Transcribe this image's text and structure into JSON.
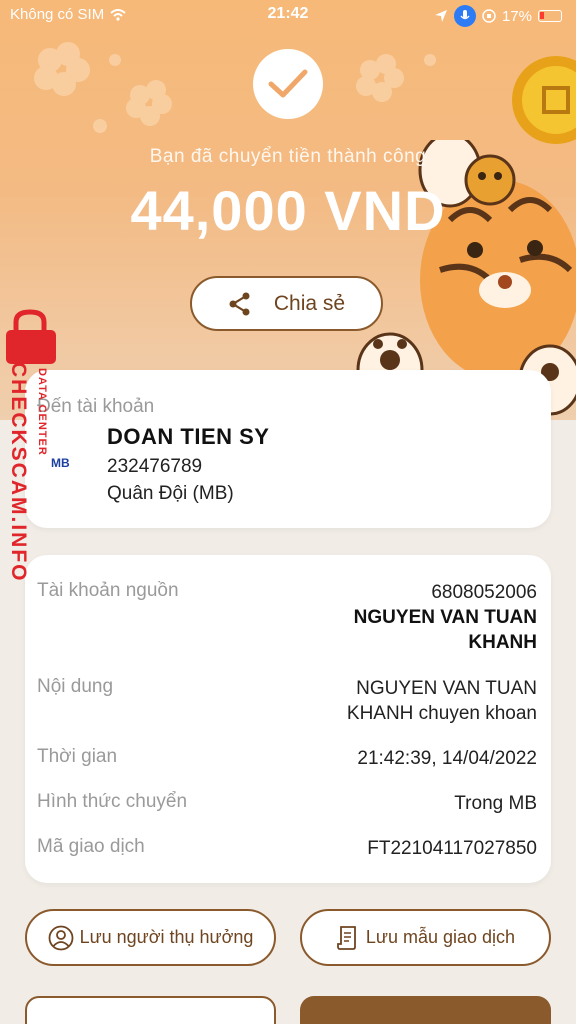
{
  "status_bar": {
    "carrier": "Không có SIM",
    "time": "21:42",
    "battery": "17%"
  },
  "hero": {
    "success_message": "Bạn đã chuyển tiền thành công",
    "amount": "44,000 VND",
    "share_label": "Chia sẻ"
  },
  "recipient": {
    "label": "Đến tài khoản",
    "name": "DOAN TIEN SY",
    "account": "232476789",
    "bank": "Quân Đội (MB)",
    "bank_logo": "MB"
  },
  "details": {
    "source_label": "Tài khoản nguồn",
    "source_account": "6808052006",
    "source_name_line1": "NGUYEN VAN TUAN",
    "source_name_line2": "KHANH",
    "content_label": "Nội dung",
    "content_line1": "NGUYEN VAN TUAN",
    "content_line2": "KHANH chuyen khoan",
    "time_label": "Thời gian",
    "time_value": "21:42:39, 14/04/2022",
    "method_label": "Hình thức chuyển",
    "method_value": "Trong MB",
    "txn_label": "Mã giao dịch",
    "txn_value": "FT22104117027850"
  },
  "actions": {
    "save_beneficiary": "Lưu người thụ hưởng",
    "save_template": "Lưu mẫu giao dịch"
  },
  "watermark": {
    "main": "CHECKSCAM.INFO",
    "sub": "DATA CENTER"
  },
  "icons": {
    "check": "check-icon",
    "share": "share-icon",
    "person": "person-icon",
    "document": "document-icon"
  },
  "colors": {
    "accent_brown": "#8a5a2c",
    "hero_orange": "#f6b978",
    "watermark_red": "#e0262b"
  }
}
